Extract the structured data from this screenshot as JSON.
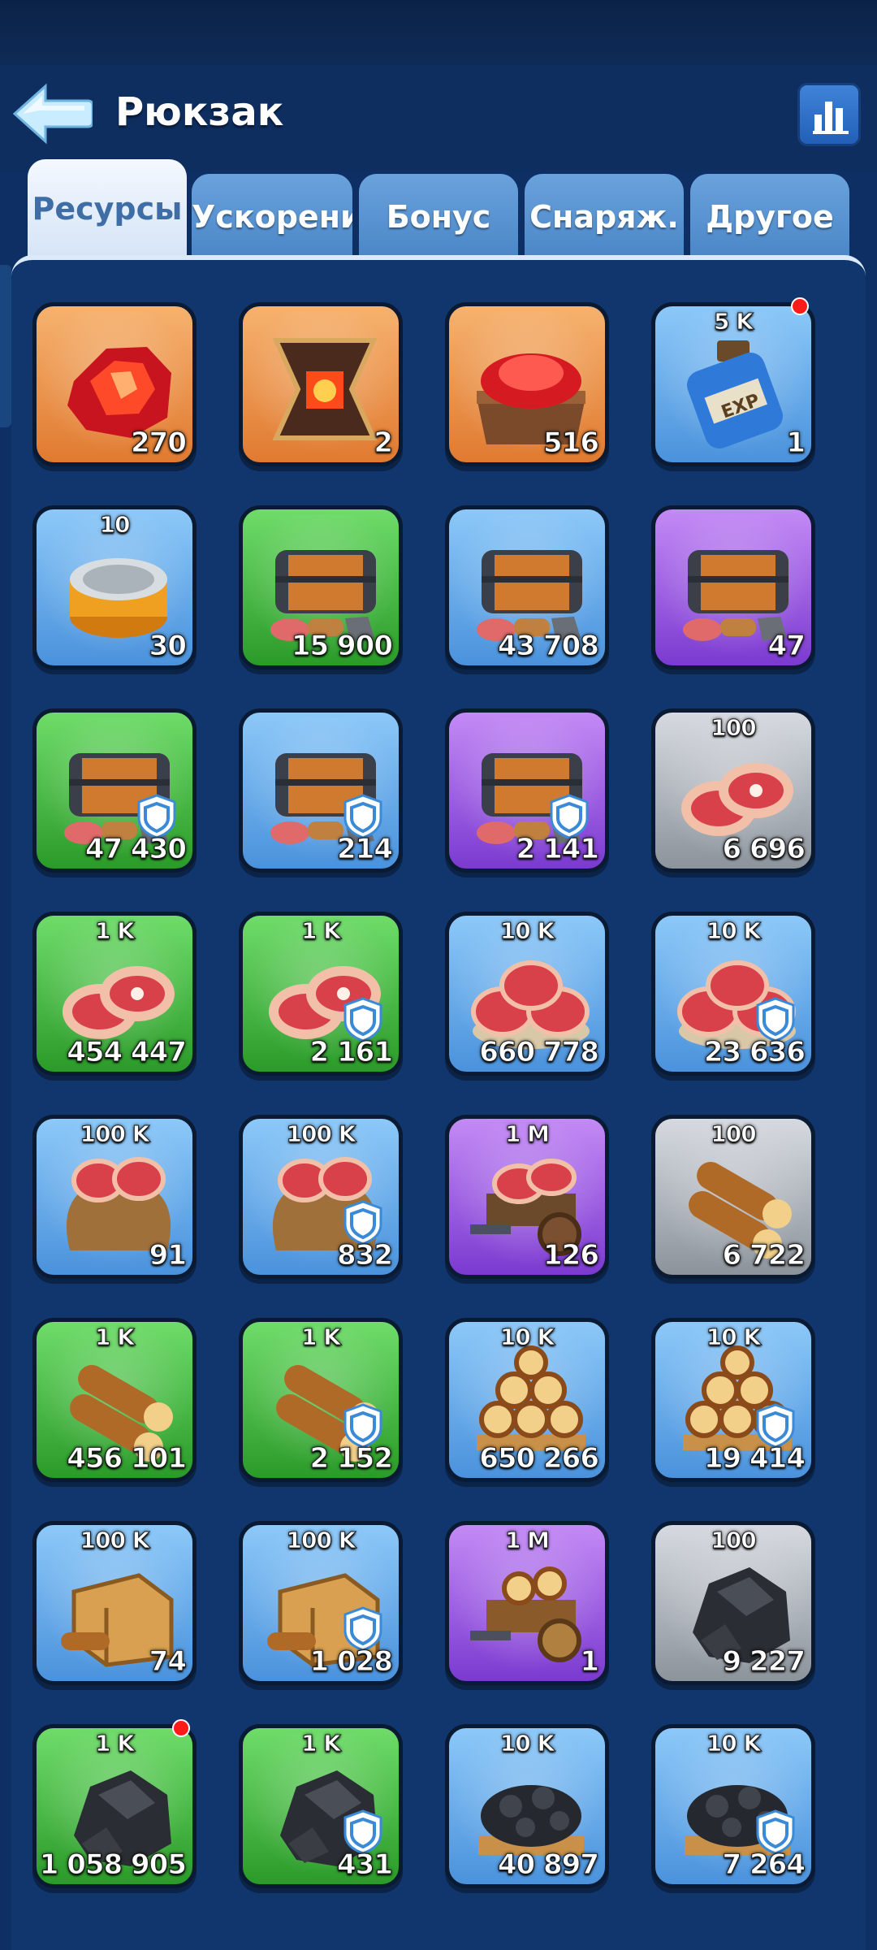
{
  "header": {
    "title": "Рюкзак"
  },
  "tabs": [
    {
      "label": "Ресурсы",
      "active": true
    },
    {
      "label": "Ускорение",
      "active": false
    },
    {
      "label": "Бонус",
      "active": false
    },
    {
      "label": "Снаряж.",
      "active": false
    },
    {
      "label": "Другое",
      "active": false
    }
  ],
  "colors": {
    "background": "#0d2f63",
    "panel": "#10366d",
    "rarity_orange": "#e07a30",
    "rarity_blue": "#4a92dc",
    "rarity_green": "#2a9a28",
    "rarity_purple": "#7b3ad0",
    "rarity_gray": "#8c939b",
    "notification": "#ff1a1a"
  },
  "items": [
    {
      "icon": "red-crystal-icon",
      "rarity": "orange",
      "amount": "",
      "count": "270"
    },
    {
      "icon": "forge-anvil-icon",
      "rarity": "orange",
      "amount": "",
      "count": "2"
    },
    {
      "icon": "ruby-crate-icon",
      "rarity": "orange",
      "amount": "",
      "count": "516"
    },
    {
      "icon": "exp-potion-icon",
      "rarity": "blue",
      "amount": "5 K",
      "count": "1",
      "notification": true
    },
    {
      "icon": "tin-can-icon",
      "rarity": "blue",
      "amount": "10",
      "count": "30"
    },
    {
      "icon": "resource-chest-icon",
      "rarity": "green",
      "amount": "",
      "count": "15 900"
    },
    {
      "icon": "resource-chest-icon",
      "rarity": "blue",
      "amount": "",
      "count": "43 708"
    },
    {
      "icon": "resource-chest-icon",
      "rarity": "purple",
      "amount": "",
      "count": "47"
    },
    {
      "icon": "resource-chest-icon",
      "rarity": "green",
      "amount": "",
      "count": "47 430",
      "shield": true
    },
    {
      "icon": "resource-chest-icon",
      "rarity": "blue",
      "amount": "",
      "count": "214",
      "shield": true
    },
    {
      "icon": "resource-chest-icon",
      "rarity": "purple",
      "amount": "",
      "count": "2 141",
      "shield": true
    },
    {
      "icon": "meat-icon",
      "rarity": "gray",
      "amount": "100",
      "count": "6 696"
    },
    {
      "icon": "meat-icon",
      "rarity": "green",
      "amount": "1 K",
      "count": "454 447"
    },
    {
      "icon": "meat-icon",
      "rarity": "green",
      "amount": "1 K",
      "count": "2 161",
      "shield": true
    },
    {
      "icon": "meat-pile-icon",
      "rarity": "blue",
      "amount": "10 K",
      "count": "660 778"
    },
    {
      "icon": "meat-pile-icon",
      "rarity": "blue",
      "amount": "10 K",
      "count": "23 636",
      "shield": true
    },
    {
      "icon": "meat-sack-icon",
      "rarity": "blue",
      "amount": "100 K",
      "count": "91"
    },
    {
      "icon": "meat-sack-icon",
      "rarity": "blue",
      "amount": "100 K",
      "count": "832",
      "shield": true
    },
    {
      "icon": "meat-cart-icon",
      "rarity": "purple",
      "amount": "1 M",
      "count": "126"
    },
    {
      "icon": "wood-icon",
      "rarity": "gray",
      "amount": "100",
      "count": "6 722"
    },
    {
      "icon": "wood-icon",
      "rarity": "green",
      "amount": "1 K",
      "count": "456 101"
    },
    {
      "icon": "wood-icon",
      "rarity": "green",
      "amount": "1 K",
      "count": "2 152",
      "shield": true
    },
    {
      "icon": "wood-pile-icon",
      "rarity": "blue",
      "amount": "10 K",
      "count": "650 266"
    },
    {
      "icon": "wood-pile-icon",
      "rarity": "blue",
      "amount": "10 K",
      "count": "19 414",
      "shield": true
    },
    {
      "icon": "wood-crate-icon",
      "rarity": "blue",
      "amount": "100 K",
      "count": "74"
    },
    {
      "icon": "wood-crate-icon",
      "rarity": "blue",
      "amount": "100 K",
      "count": "1 028",
      "shield": true
    },
    {
      "icon": "wood-cart-icon",
      "rarity": "purple",
      "amount": "1 M",
      "count": "1"
    },
    {
      "icon": "coal-icon",
      "rarity": "gray",
      "amount": "100",
      "count": "9 227"
    },
    {
      "icon": "coal-icon",
      "rarity": "green",
      "amount": "1 K",
      "count": "1 058 905",
      "notification": true
    },
    {
      "icon": "coal-icon",
      "rarity": "green",
      "amount": "1 K",
      "count": "431",
      "shield": true
    },
    {
      "icon": "coal-pile-icon",
      "rarity": "blue",
      "amount": "10 K",
      "count": "40 897"
    },
    {
      "icon": "coal-pile-icon",
      "rarity": "blue",
      "amount": "10 K",
      "count": "7 264",
      "shield": true
    }
  ]
}
